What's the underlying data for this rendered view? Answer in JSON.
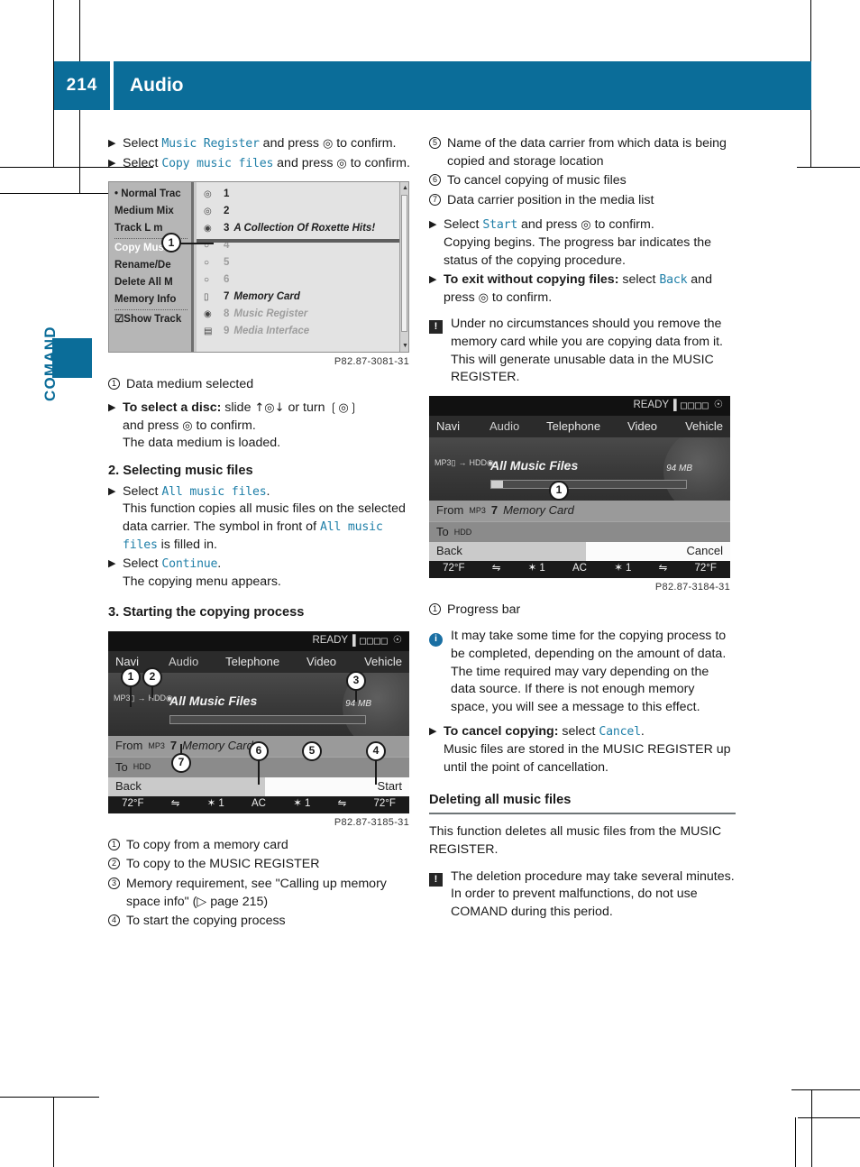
{
  "header": {
    "page_number": "214",
    "title": "Audio"
  },
  "side_tab": {
    "label": "COMAND"
  },
  "colors": {
    "brand_blue": "#0b6d99",
    "code_blue": "#1f7fa8",
    "rule_gray": "#6e7577"
  },
  "left_column": {
    "steps": [
      {
        "pre": "Select ",
        "code": "Music Register",
        "post": " and press ",
        "glyph": "◎",
        "tail": " to confirm."
      },
      {
        "pre": "Select ",
        "code": "Copy music files",
        "post": " and press ",
        "glyph": "◎",
        "tail": " to confirm."
      }
    ],
    "figure_media_list": {
      "caption": "P82.87-3081-31",
      "left_menu": [
        "• Normal Trac",
        "Medium Mix",
        "Track L     m",
        "Copy Music",
        "Rename/De",
        "Delete All M",
        "Memory Info",
        "☑Show Track"
      ],
      "entries": [
        {
          "icon": "disc-icon",
          "num": "1",
          "name": "",
          "dim": false
        },
        {
          "icon": "disc-icon",
          "num": "2",
          "name": "",
          "dim": false
        },
        {
          "icon": "cd-icon",
          "num": "3",
          "name": "A Collection Of Roxette Hits!",
          "dim": false
        },
        {
          "icon": "empty-slot-icon",
          "num": "4",
          "name": "",
          "dim": true
        },
        {
          "icon": "empty-slot-icon",
          "num": "5",
          "name": "",
          "dim": true
        },
        {
          "icon": "empty-slot-icon",
          "num": "6",
          "name": "",
          "dim": true
        },
        {
          "icon": "memory-card-icon",
          "num": "7",
          "name": "Memory Card",
          "dim": false
        },
        {
          "icon": "hdd-icon",
          "num": "8",
          "name": "Music Register",
          "dim": true
        },
        {
          "icon": "media-icon",
          "num": "9",
          "name": "Media Interface",
          "dim": true
        }
      ],
      "callout": "1"
    },
    "callout_1": {
      "num": "1",
      "text": "Data medium selected"
    },
    "select_disc": {
      "bold": "To select a disc:",
      "mid1": " slide ",
      "glyph_slide": "↑◎↓",
      "mid2": " or turn ",
      "glyph_turn": "❲◎❳",
      "tail": "and press ",
      "glyph_press": "◎",
      "tail2": " to confirm.",
      "result": "The data medium is loaded."
    },
    "section_2": {
      "heading": "2. Selecting music files",
      "step1_pre": "Select ",
      "step1_code": "All music files",
      "step1_post": ".",
      "step1_body_a": "This function copies all music files on the selected data carrier. The symbol in front of ",
      "step1_body_code": "All music files",
      "step1_body_b": " is filled in.",
      "step2_pre": "Select ",
      "step2_code": "Continue",
      "step2_post": ".",
      "step2_body": "The copying menu appears."
    },
    "section_3": {
      "heading": "3. Starting the copying process"
    },
    "figure_copy_menu": {
      "caption": "P82.87-3185-31",
      "status": {
        "ready": "READY",
        "bars": "▌□□□□",
        "phone": "phone-icon"
      },
      "menu": [
        "Navi",
        "Audio",
        "Telephone",
        "Video",
        "Vehicle"
      ],
      "source_icons": "MP3 → HDD",
      "title": "All Music Files",
      "size": "94 MB",
      "progress_percent": 0,
      "from_label": "From",
      "from_device": "MP3",
      "from_position": "7",
      "from_name": "Memory Card",
      "to_label": "To",
      "to_device": "HDD",
      "button_left": "Back",
      "button_right": "Start",
      "climate": [
        "72°F",
        "⇋",
        "✶ 1",
        "AC",
        "✶ 1",
        "⇋",
        "72°F"
      ],
      "callouts": [
        "1",
        "2",
        "3",
        "4",
        "5",
        "6",
        "7"
      ]
    },
    "callouts_bottom": [
      {
        "num": "1",
        "text": "To copy from a memory card"
      },
      {
        "num": "2",
        "text": "To copy to the MUSIC REGISTER"
      },
      {
        "num": "3",
        "text": "Memory requirement, see \"Calling up memory space info\" (▷ page 215)"
      },
      {
        "num": "4",
        "text": "To start the copying process"
      }
    ]
  },
  "right_column": {
    "callouts_top": [
      {
        "num": "5",
        "text": "Name of the data carrier from which data is being copied and storage location"
      },
      {
        "num": "6",
        "text": "To cancel copying of music files"
      },
      {
        "num": "7",
        "text": "Data carrier position in the media list"
      }
    ],
    "start_step": {
      "pre": "Select ",
      "code": "Start",
      "post": " and press ",
      "glyph": "◎",
      "tail": " to confirm.",
      "body": "Copying begins. The progress bar indicates the status of the copying procedure."
    },
    "exit_step": {
      "bold": "To exit without copying files:",
      "mid": " select ",
      "code": "Back",
      "post": " and press ",
      "glyph": "◎",
      "tail": " to confirm."
    },
    "warning_1": {
      "icon": "warning-icon",
      "text": "Under no circumstances should you remove the memory card while you are copying data from it. This will generate unusable data in the MUSIC REGISTER."
    },
    "figure_progress": {
      "caption": "P82.87-3184-31",
      "status": {
        "ready": "READY",
        "bars": "▌□□□□",
        "phone": "phone-icon"
      },
      "menu": [
        "Navi",
        "Audio",
        "Telephone",
        "Video",
        "Vehicle"
      ],
      "title": "All Music Files",
      "size": "94 MB",
      "progress_percent": 6,
      "from_label": "From",
      "from_device": "MP3",
      "from_position": "7",
      "from_name": "Memory Card",
      "to_label": "To",
      "to_device": "HDD",
      "button_left": "Back",
      "button_right": "Cancel",
      "climate": [
        "72°F",
        "⇋",
        "✶ 1",
        "AC",
        "✶ 1",
        "⇋",
        "72°F"
      ],
      "callout": "1"
    },
    "callout_progress": {
      "num": "1",
      "text": "Progress bar"
    },
    "info_1": {
      "icon": "info-icon",
      "text": "It may take some time for the copying process to be completed, depending on the amount of data. The time required may vary depending on the data source. If there is not enough memory space, you will see a message to this effect."
    },
    "cancel_step": {
      "bold": "To cancel copying:",
      "mid": " select ",
      "code": "Cancel",
      "post": ".",
      "body": "Music files are stored in the MUSIC REGISTER up until the point of cancellation."
    },
    "deleting_section": {
      "heading": "Deleting all music files",
      "body": "This function deletes all music files from the MUSIC REGISTER.",
      "warning": {
        "icon": "warning-icon",
        "text": "The deletion procedure may take several minutes. In order to prevent malfunctions, do not use COMAND during this period."
      }
    }
  }
}
